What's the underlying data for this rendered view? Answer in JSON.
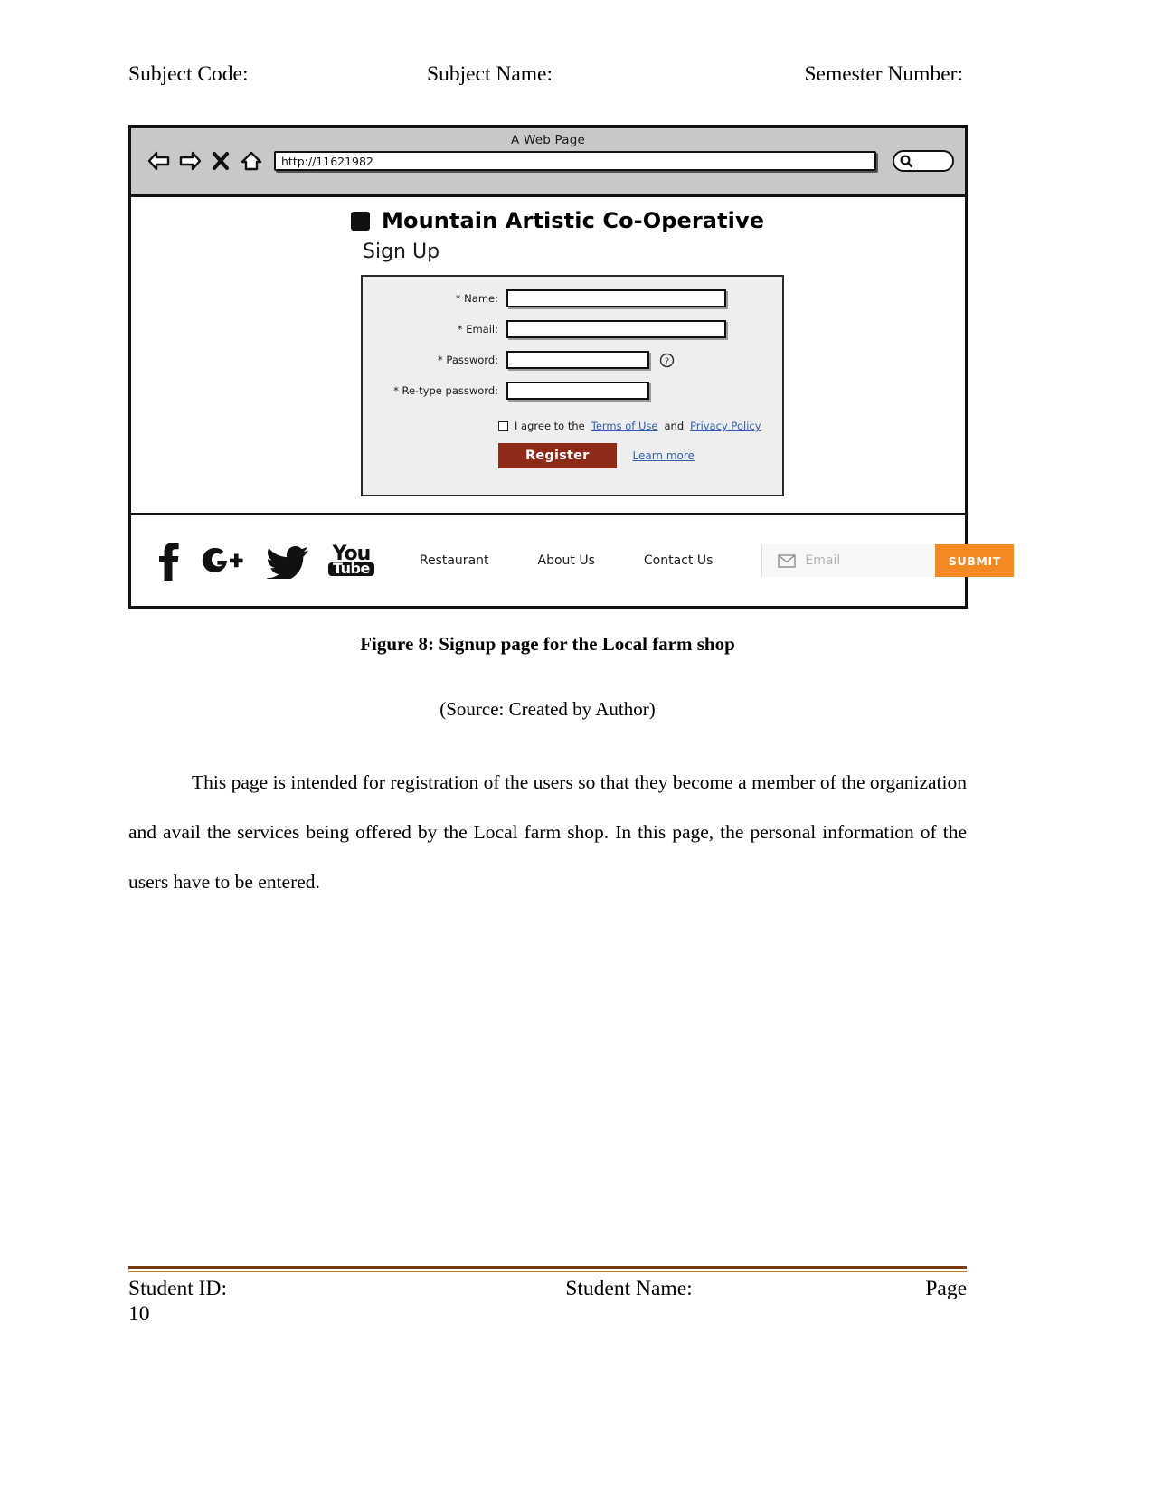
{
  "document": {
    "header": {
      "subject_code": "Subject Code:",
      "subject_name": "Subject Name:",
      "semester_number": "Semester Number:"
    },
    "caption": "Figure 8: Signup page for the Local farm shop",
    "source": "(Source: Created by Author)",
    "body_paragraph": "This page is intended for registration of the users so that they become a member of the organization and avail the services being offered by the Local farm shop. In this page, the personal information of the users have to be entered.",
    "footer": {
      "student_id": "Student ID:",
      "student_name": "Student Name:",
      "page_label": "Page",
      "page_number": "10",
      "rule_color_dark": "#7a3b10",
      "rule_color_light": "#c07a2b"
    }
  },
  "mockup": {
    "browser": {
      "title": "A Web Page",
      "url_value": "http://11621982",
      "icons": {
        "back": "back-arrow-icon",
        "forward": "forward-arrow-icon",
        "stop": "stop-x-icon",
        "home": "home-icon",
        "search": "search-icon"
      },
      "chrome_color": "#c8c8c8"
    },
    "site": {
      "brand": "Mountain Artistic Co-Operative",
      "page_title": "Sign Up",
      "form": {
        "fields": [
          {
            "label": "* Name:",
            "value": "",
            "size": "long",
            "help": false
          },
          {
            "label": "* Email:",
            "value": "",
            "size": "long",
            "help": false
          },
          {
            "label": "* Password:",
            "value": "",
            "size": "short",
            "help": true
          },
          {
            "label": "* Re-type password:",
            "value": "",
            "size": "short",
            "help": false
          }
        ],
        "agree_prefix": "I agree to the",
        "terms_link": "Terms of Use",
        "agree_middle": "and",
        "privacy_link": "Privacy Policy",
        "agree_suffix": ".",
        "register_label": "Register",
        "learn_more_label": "Learn more",
        "register_color": "#8e2a18",
        "link_color": "#3061a8",
        "card_background": "#eeeeee"
      },
      "footer": {
        "socials": [
          "facebook-icon",
          "google-plus-icon",
          "twitter-icon",
          "youtube-icon"
        ],
        "youtube_top": "You",
        "youtube_bottom": "Tube",
        "google_plus_text": "G+",
        "nav": [
          "Restaurant",
          "About Us",
          "Contact Us"
        ],
        "email_placeholder": "Email",
        "email_value": "",
        "submit_label": "SUBMIT",
        "submit_color": "#f28a21"
      }
    }
  }
}
